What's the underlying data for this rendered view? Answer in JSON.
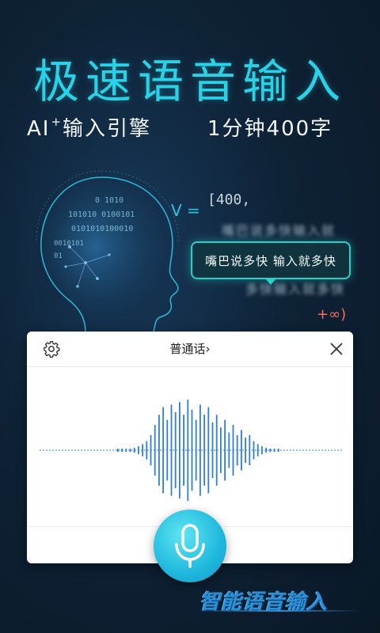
{
  "header": {
    "title": "极速语音输入",
    "subtitle_left": "AI",
    "subtitle_left_sup": "+",
    "subtitle_left_rest": "输入引擎",
    "subtitle_right": "1分钟400字"
  },
  "formula": {
    "v_label": "V =",
    "interval_start": "[400,",
    "interval_end": "+∞)",
    "blur_top": "嘴巴说多快输入就",
    "blur_bottom": "多快输入就多快"
  },
  "speech_bubble": {
    "text": "嘴巴说多快  输入就多快"
  },
  "head": {
    "binary_lines": [
      "0 1010",
      "101010 0100101",
      "0101010100010",
      "0010101",
      "01"
    ]
  },
  "voice_panel": {
    "language": "普通话",
    "language_chevron": "›"
  },
  "waveform": {
    "amplitudes": [
      0.02,
      0.02,
      0.02,
      0.03,
      0.05,
      0.08,
      0.12,
      0.18,
      0.3,
      0.5,
      0.7,
      0.85,
      0.6,
      0.9,
      0.75,
      0.95,
      0.7,
      1.0,
      0.8,
      0.6,
      0.9,
      0.7,
      0.85,
      0.55,
      0.7,
      0.45,
      0.6,
      0.35,
      0.5,
      0.3,
      0.4,
      0.25,
      0.3,
      0.18,
      0.12,
      0.08,
      0.05,
      0.03,
      0.02,
      0.02
    ]
  },
  "brand": {
    "slogan": "智能语音输入"
  },
  "colors": {
    "accent": "#28d3e8",
    "bubble_border": "#2ad0c8",
    "waveform": "#2f7fd8",
    "infinity": "#ff6a5a",
    "slogan": "#2b8fd6"
  }
}
